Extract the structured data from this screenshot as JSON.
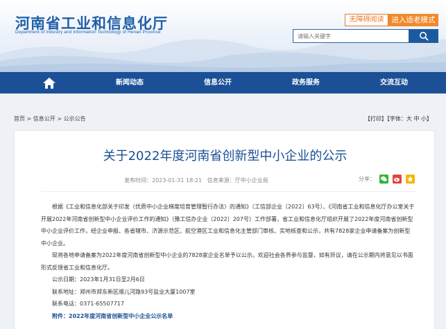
{
  "header": {
    "logo_cn": "河南省工业和信息化厅",
    "logo_en": "Department of Industry and Information Technology of Henan Province",
    "barrier_free": "无障碍阅读",
    "elder_mode": "进入适老模式",
    "search_placeholder": "请输入关键字"
  },
  "nav": {
    "items": [
      "新闻动态",
      "信息公开",
      "政务服务",
      "交流互动"
    ]
  },
  "breadcrumb": {
    "home": "首页",
    "sep1": " > ",
    "level1": "信息公开",
    "sep2": " > ",
    "level2": "公示公告",
    "print": "【打印】",
    "font_label": "【字体：",
    "font_large": "大",
    "font_medium": "中",
    "font_small": "小",
    "font_close": "】"
  },
  "article": {
    "title": "关于2022年度河南省创新型中小企业的公示",
    "publish_time": "发布时间：2023-01-31 18:21",
    "source": "信息来源：厅中小企业局",
    "share_label": "分享：",
    "para1": "根据《工业和信息化部关于印发〈优质中小企业梯度培育管理暂行办法〉的通知》（工信部企业〔2022〕63号）、《河南省工业和信息化厅办公室关于开展2022年河南省创新型中小企业评价工作的通知》（豫工信办企业〔2022〕207号）工作部署，省工业和信息化厅组织开展了2022年度河南省创新型中小企业评价工作，经企业申报、各省辖市、济源示范区、航空港区工业和信息化主管部门审核、实地核查和公示，共有7828家企业申请备案为创新型中小企业。",
    "para2": "现将各地申请备案为2022年度河南省创新型中小企业的7828家企业名单予以公示。欢迎社会各界参与监督，如有异议，请在公示期内将意见以书面形式反馈省工业和信息化厅。",
    "date": "公示日期：2023年1月31日至2月6日",
    "address": "联系地址：郑州市郑东新区顺儿河路93号盐业大厦1007室",
    "phone": "联系电话：0371-65507717",
    "attachment": "附件：2022年度河南省创新型中小企业公示名单"
  },
  "colors": {
    "brand_blue": "#1b5097",
    "title_blue": "#1b4f93",
    "accent_orange": "#f08a2a",
    "wechat_green": "#2fb534",
    "weibo_red": "#e0463d",
    "qzone_yellow": "#f5b400"
  },
  "icons": [
    "home-icon",
    "search-icon",
    "wechat-icon",
    "weibo-icon",
    "qzone-icon"
  ]
}
